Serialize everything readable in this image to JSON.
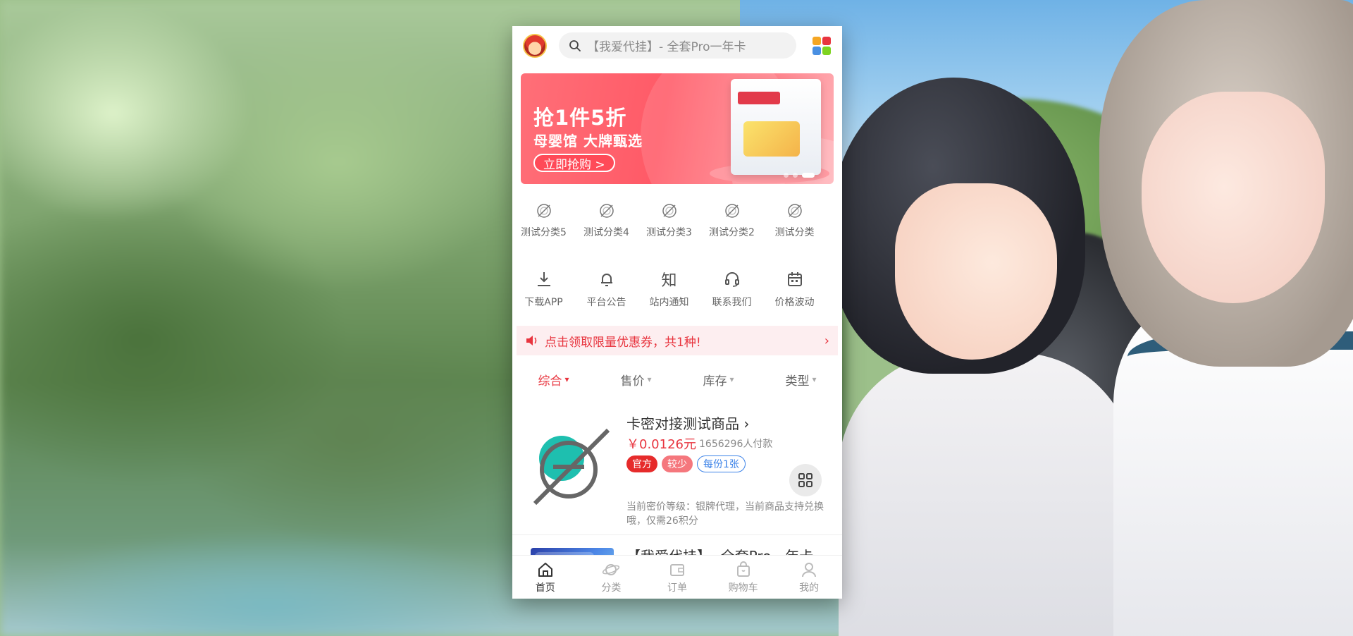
{
  "search": {
    "placeholder": "【我爱代挂】- 全套Pro一年卡"
  },
  "banner": {
    "title": "抢1件5折",
    "subtitle": "母婴馆 大牌甄选",
    "button": "立即抢购 >",
    "slide_count": 3,
    "active_slide": 3
  },
  "categories": [
    {
      "label": "测试分类5",
      "icon": "category-icon"
    },
    {
      "label": "测试分类4",
      "icon": "category-icon"
    },
    {
      "label": "测试分类3",
      "icon": "category-icon"
    },
    {
      "label": "测试分类2",
      "icon": "category-icon"
    },
    {
      "label": "测试分类",
      "icon": "category-icon"
    }
  ],
  "tools": [
    {
      "label": "下载APP",
      "icon": "download-icon"
    },
    {
      "label": "平台公告",
      "icon": "bell-icon"
    },
    {
      "label": "站内通知",
      "icon": "知"
    },
    {
      "label": "联系我们",
      "icon": "headset-icon"
    },
    {
      "label": "价格波动",
      "icon": "calendar-icon"
    }
  ],
  "notice": {
    "text": "点击领取限量优惠券，共1种!",
    "arrow": "›"
  },
  "filters": [
    {
      "label": "综合",
      "active": true
    },
    {
      "label": "售价",
      "active": false
    },
    {
      "label": "库存",
      "active": false
    },
    {
      "label": "类型",
      "active": false
    }
  ],
  "products": [
    {
      "title": "卡密对接测试商品 ›",
      "price": "￥0.0126元",
      "buyers": "1656296人付款",
      "tags": [
        "官方",
        "较少",
        "每份1张"
      ],
      "desc": "当前密价等级：银牌代理，当前商品支持兑换哦，仅需26积分"
    },
    {
      "title": "【我爱代挂】- 全套Pro一年卡",
      "more": "›"
    }
  ],
  "tabbar": [
    {
      "label": "首页",
      "icon": "home-icon",
      "active": true
    },
    {
      "label": "分类",
      "icon": "planet-icon",
      "active": false
    },
    {
      "label": "订单",
      "icon": "wallet-icon",
      "active": false
    },
    {
      "label": "购物车",
      "icon": "bag-icon",
      "active": false
    },
    {
      "label": "我的",
      "icon": "user-icon",
      "active": false
    }
  ],
  "colors": {
    "accent": "#e8353f",
    "tag_blue": "#3b82e8",
    "banner": "#ff5a67"
  }
}
